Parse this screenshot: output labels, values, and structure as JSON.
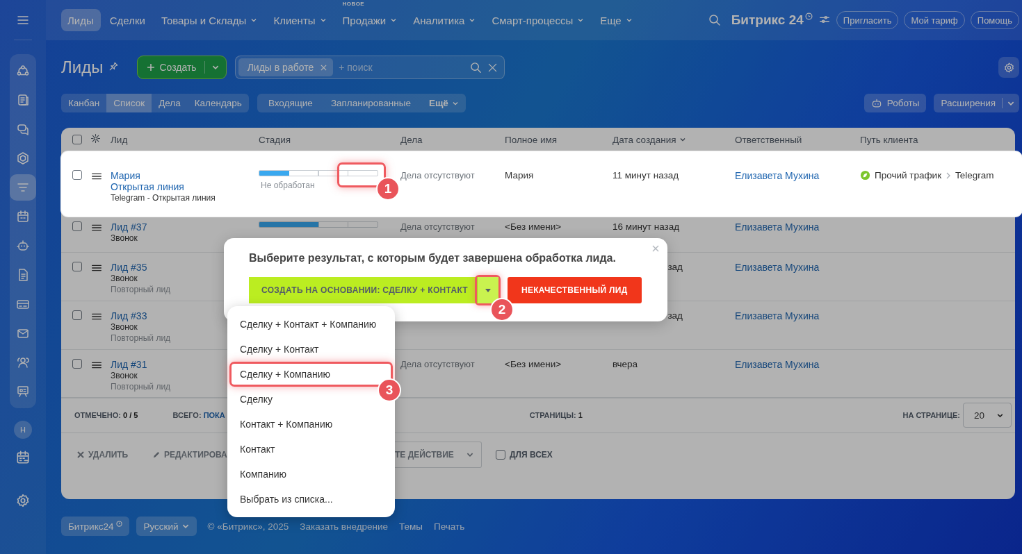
{
  "sidebar": {
    "items": [
      {
        "selected": false
      },
      {
        "selected": false
      },
      {
        "selected": false
      },
      {
        "selected": false
      },
      {
        "selected": true
      },
      {
        "selected": false
      },
      {
        "selected": false
      },
      {
        "selected": false
      },
      {
        "selected": false
      },
      {
        "selected": false
      },
      {
        "selected": false
      },
      {
        "selected": false
      }
    ],
    "avatar": "Н"
  },
  "topbar": {
    "nav": [
      {
        "label": "Лиды",
        "selected": true,
        "dropdown": false
      },
      {
        "label": "Сделки",
        "selected": false,
        "dropdown": false
      },
      {
        "label": "Товары и Склады",
        "selected": false,
        "dropdown": true
      },
      {
        "label": "Клиенты",
        "selected": false,
        "dropdown": true
      },
      {
        "label": "Продажи",
        "selected": false,
        "dropdown": true,
        "badge": "НОВОЕ"
      },
      {
        "label": "Аналитика",
        "selected": false,
        "dropdown": true
      },
      {
        "label": "Смарт-процессы",
        "selected": false,
        "dropdown": true
      },
      {
        "label": "Еще",
        "selected": false,
        "dropdown": true
      }
    ],
    "logo": "Битрикс 24",
    "buttons": [
      "Пригласить",
      "Мой тариф",
      "Помощь"
    ]
  },
  "page": {
    "title": "Лиды",
    "create_button": "Создать",
    "filter": {
      "tag": "Лиды в работе",
      "placeholder": "+ поиск"
    },
    "views": [
      {
        "label": "Канбан",
        "selected": false
      },
      {
        "label": "Список",
        "selected": true
      },
      {
        "label": "Дела",
        "selected": false
      },
      {
        "label": "Календарь",
        "selected": false
      }
    ],
    "filters": [
      "Входящие",
      "Запланированные"
    ],
    "filters_more": "Ещё",
    "robots": "Роботы",
    "extensions": "Расширения"
  },
  "table": {
    "all_checked": false,
    "columns": [
      "Лид",
      "Стадия",
      "Дела",
      "Полное имя",
      "Дата создания",
      "Ответственный",
      "Путь клиента"
    ],
    "rows": [
      {
        "checked": false,
        "highlighted": true,
        "lead": "Мария",
        "lines": [
          {
            "kind": "link",
            "text": "Открытая линия"
          },
          {
            "kind": "source",
            "text": "Telegram - Открытая линия"
          }
        ],
        "stage": {
          "level": 0.25,
          "label": "Не обработан",
          "highlighted": true
        },
        "activities": "Дела отсутствуют",
        "full_name": "Мария",
        "created": "11 минут назад",
        "created_clipped": false,
        "responsible": "Елизавета Мухина",
        "path": [
          "Прочий трафик",
          "Telegram"
        ]
      },
      {
        "checked": false,
        "highlighted": false,
        "lead": "Лид #37",
        "lines": [
          {
            "kind": "source",
            "text": "Звонок"
          }
        ],
        "stage": {
          "level": 0.5
        },
        "activities": "Дела отсутствуют",
        "full_name": "<Без имени>",
        "created": "16 минут назад",
        "created_clipped": false,
        "responsible": "Елизавета Мухина"
      },
      {
        "checked": false,
        "highlighted": false,
        "lead": "Лид #35",
        "lines": [
          {
            "kind": "source",
            "text": "Звонок"
          },
          {
            "kind": "note",
            "text": "Повторный лид"
          }
        ],
        "created": "зад",
        "created_clipped": true,
        "responsible": "Елизавета Мухина"
      },
      {
        "checked": false,
        "highlighted": false,
        "lead": "Лид #33",
        "lines": [
          {
            "kind": "source",
            "text": "Звонок"
          },
          {
            "kind": "note",
            "text": "Повторный лид"
          }
        ],
        "created": "зад",
        "created_clipped": true,
        "responsible": "Елизавета Мухина"
      },
      {
        "checked": false,
        "highlighted": false,
        "lead": "Лид #31",
        "lines": [
          {
            "kind": "source",
            "text": "Звонок"
          },
          {
            "kind": "note",
            "text": "Повторный лид"
          }
        ],
        "activities": "Дела отсутствуют",
        "full_name": "<Без имени>",
        "created": "вчера",
        "created_clipped": false,
        "responsible": "Елизавета Мухина"
      }
    ],
    "summary": {
      "selected_label": "ОТМЕЧЕНО:",
      "selected_value": "0 / 5",
      "total_label": "ВСЕГО:",
      "total_link": "ПОКА",
      "pages_label": "СТРАНИЦЫ:",
      "pages_value": "1",
      "per_page_label": "НА СТРАНИЦЕ:",
      "per_page": "20"
    },
    "actions": {
      "delete": "УДАЛИТЬ",
      "edit": "РЕДАКТИРОВА",
      "action_select": "ТЕ ДЕЙСТВИЕ",
      "for_all": {
        "label": "ДЛЯ ВСЕХ",
        "checked": false
      }
    }
  },
  "popup": {
    "title": "Выберите результат, с которым будет завершена обработка лида.",
    "primary_button": "СОЗДАТЬ НА ОСНОВАНИИ: СДЕЛКУ + КОНТАКТ",
    "reject_button": "НЕКАЧЕСТВЕННЫЙ ЛИД",
    "dropdown_highlighted": true
  },
  "menu": {
    "items": [
      {
        "label": "Сделку + Контакт + Компанию",
        "highlighted": false
      },
      {
        "label": "Сделку + Контакт",
        "highlighted": false
      },
      {
        "label": "Сделку + Компанию",
        "highlighted": true
      },
      {
        "label": "Сделку",
        "highlighted": false
      },
      {
        "label": "Контакт + Компанию",
        "highlighted": false
      },
      {
        "label": "Контакт",
        "highlighted": false
      },
      {
        "label": "Компанию",
        "highlighted": false
      },
      {
        "label": "Выбрать из списка...",
        "highlighted": false
      }
    ]
  },
  "footer": {
    "brand": "Битрикс24",
    "language": "Русский",
    "copyright": "© «Битрикс», 2025",
    "links": [
      "Заказать внедрение",
      "Темы",
      "Печать"
    ]
  },
  "callouts": [
    "1",
    "2",
    "3"
  ]
}
